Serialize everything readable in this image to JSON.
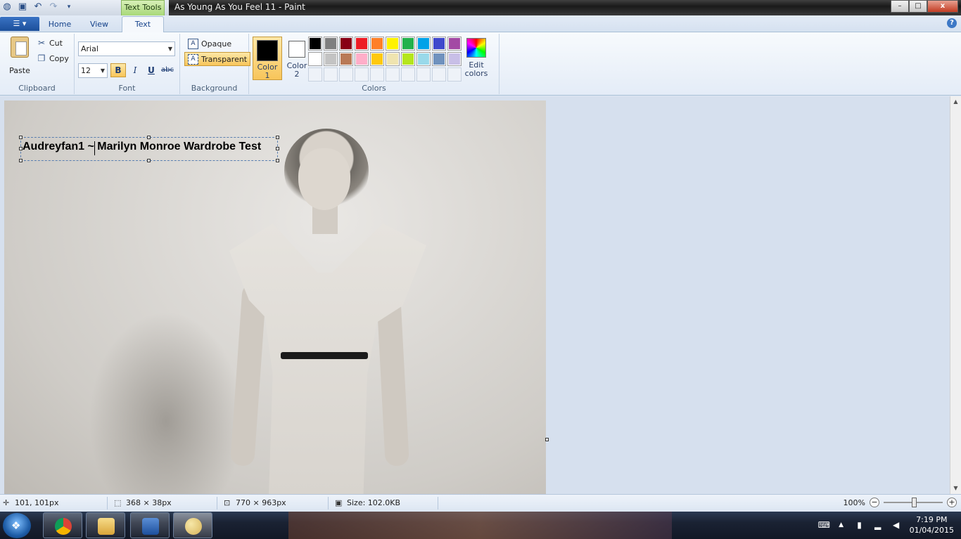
{
  "window": {
    "context_tab": "Text Tools",
    "title": "As Young As You Feel 11 - Paint",
    "controls": {
      "minimize": "–",
      "maximize": "□",
      "close": "x"
    }
  },
  "quick_access": {
    "icons": [
      "paint-app-icon",
      "save-icon",
      "undo-icon",
      "redo-icon",
      "customize-dropdown-icon"
    ]
  },
  "tabs": {
    "file_glyph": "☰ ▾",
    "items": [
      "Home",
      "View",
      "Text"
    ],
    "active": "Text",
    "help": "?"
  },
  "ribbon": {
    "clipboard": {
      "label": "Clipboard",
      "paste": "Paste",
      "cut": "Cut",
      "copy": "Copy"
    },
    "font": {
      "label": "Font",
      "family": "Arial",
      "size": "12",
      "bold": "B",
      "italic": "I",
      "underline": "U",
      "strike": "abc",
      "bold_on": true
    },
    "background": {
      "label": "Background",
      "opaque": "Opaque",
      "transparent": "Transparent",
      "selected": "Transparent"
    },
    "colors": {
      "label": "Colors",
      "color1_label": "Color 1",
      "color1_line1": "Color",
      "color1_line2": "1",
      "color1_value": "#000000",
      "color2_label": "Color 2",
      "color2_line1": "Color",
      "color2_line2": "2",
      "color2_value": "#ffffff",
      "palette_row1": [
        "#000000",
        "#7f7f7f",
        "#880015",
        "#ed1c24",
        "#ff7f27",
        "#fff200",
        "#22b14c",
        "#00a2e8",
        "#3f48cc",
        "#a349a4"
      ],
      "palette_row2": [
        "#ffffff",
        "#c3c3c3",
        "#b97a57",
        "#ffaec9",
        "#ffc90e",
        "#efe4b0",
        "#b5e61d",
        "#99d9ea",
        "#7092be",
        "#c8bfe7"
      ],
      "edit_line1": "Edit",
      "edit_line2": "colors"
    }
  },
  "canvas": {
    "text": "Audreyfan1 ~ Marilyn Monroe Wardrobe Test"
  },
  "status": {
    "cursor_pos": "101, 101px",
    "selection_size": "368 × 38px",
    "image_size": "770 × 963px",
    "file_size": "Size: 102.0KB",
    "zoom": "100%"
  },
  "taskbar": {
    "apps": [
      "chrome-icon",
      "explorer-icon",
      "word-icon",
      "paint-icon"
    ],
    "time": "7:19 PM",
    "date": "01/04/2015"
  }
}
